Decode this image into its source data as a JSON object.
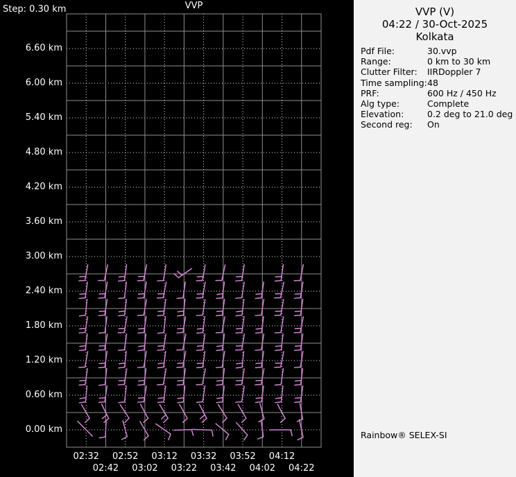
{
  "plot": {
    "title": "VVP",
    "step_label": "Step: 0.30 km",
    "y_labels": [
      "6.60 km",
      "6.00 km",
      "5.40 km",
      "4.80 km",
      "4.20 km",
      "3.60 km",
      "3.00 km",
      "2.40 km",
      "1.80 km",
      "1.20 km",
      "0.60 km",
      "0.00 km"
    ],
    "x_labels_row1": [
      "02:32",
      "02:52",
      "03:12",
      "03:32",
      "03:52",
      "04:12"
    ],
    "x_labels_row2": [
      "02:42",
      "03:02",
      "03:22",
      "03:42",
      "04:02",
      "04:22"
    ]
  },
  "chart_data": {
    "type": "wind-barb-profile",
    "title": "VVP",
    "x_times": [
      "02:32",
      "02:42",
      "02:52",
      "03:02",
      "03:12",
      "03:22",
      "03:32",
      "03:42",
      "03:52",
      "04:02",
      "04:12",
      "04:22"
    ],
    "heights_km": [
      2.7,
      2.4,
      2.1,
      1.8,
      1.5,
      1.2,
      0.9,
      0.6,
      0.3,
      0.0
    ],
    "height_axis": {
      "min": 0.0,
      "max": 7.2,
      "step_km": 0.3,
      "labeled_step_km": 0.6,
      "unit": "km"
    },
    "time_step_min": 10,
    "angles_deg": [
      [
        10,
        12,
        8,
        11,
        9,
        55,
        10,
        12,
        9,
        null,
        8,
        11
      ],
      [
        8,
        10,
        7,
        9,
        11,
        8,
        10,
        7,
        9,
        8,
        12,
        9
      ],
      [
        6,
        9,
        7,
        10,
        8,
        6,
        9,
        8,
        7,
        9,
        10,
        8
      ],
      [
        9,
        7,
        10,
        8,
        6,
        9,
        7,
        10,
        8,
        7,
        9,
        11
      ],
      [
        7,
        10,
        8,
        6,
        9,
        11,
        8,
        7,
        10,
        9,
        7,
        8
      ],
      [
        10,
        8,
        6,
        9,
        7,
        10,
        8,
        9,
        6,
        8,
        11,
        9
      ],
      [
        8,
        6,
        9,
        7,
        10,
        8,
        11,
        7,
        9,
        10,
        8,
        7
      ],
      [
        5,
        8,
        6,
        9,
        7,
        5,
        8,
        6,
        9,
        7,
        6,
        8
      ],
      [
        -30,
        -26,
        -33,
        -28,
        -31,
        -29,
        -27,
        -32,
        -30,
        -15,
        -28,
        -10
      ],
      [
        -45,
        3,
        -15,
        -30,
        -55,
        -92,
        -88,
        -50,
        -42,
        -8,
        -90,
        -12
      ]
    ],
    "feather_counts": [
      [
        2,
        1,
        2,
        2,
        1,
        2,
        2,
        1,
        2,
        0,
        2,
        1
      ],
      [
        2,
        2,
        1,
        2,
        2,
        1,
        2,
        2,
        1,
        2,
        2,
        2
      ],
      [
        1,
        2,
        2,
        1,
        2,
        2,
        1,
        2,
        2,
        1,
        2,
        2
      ],
      [
        2,
        1,
        2,
        2,
        1,
        2,
        2,
        1,
        2,
        2,
        1,
        2
      ],
      [
        2,
        2,
        1,
        2,
        2,
        1,
        2,
        2,
        2,
        1,
        2,
        2
      ],
      [
        1,
        2,
        2,
        1,
        2,
        2,
        2,
        1,
        2,
        2,
        2,
        1
      ],
      [
        2,
        1,
        2,
        2,
        1,
        2,
        1,
        2,
        2,
        2,
        1,
        2
      ],
      [
        2,
        2,
        1,
        2,
        2,
        2,
        1,
        2,
        1,
        2,
        2,
        2
      ],
      [
        1,
        2,
        1,
        1,
        2,
        1,
        2,
        1,
        1,
        1,
        1,
        1
      ],
      [
        0,
        1,
        1,
        1,
        1,
        1,
        1,
        1,
        1,
        1,
        1,
        1
      ]
    ],
    "staff_length_default": 23,
    "staff_lengths_bottom_row": [
      30,
      24,
      24,
      24,
      26,
      26,
      28,
      24,
      24,
      24,
      30,
      26
    ]
  },
  "colors": {
    "barb": "#d284d2",
    "grid_solid": "#8f8f8f",
    "grid_dotted": "#e6e6e6",
    "plot_text": "#ffffff",
    "panel_bg": "#f2f2f2",
    "panel_text": "#000000"
  },
  "panel": {
    "title": "VVP (V)",
    "datetime": "04:22 / 30-Oct-2025",
    "location": "Kolkata",
    "fields": [
      {
        "label": "Pdf File:",
        "value": "30.vvp"
      },
      {
        "label": "Range:",
        "value": "0 km to 30 km"
      },
      {
        "label": "Clutter Filter:",
        "value": "IIRDoppler 7"
      },
      {
        "label": "Time sampling:",
        "value": "48"
      },
      {
        "label": "PRF:",
        "value": "600 Hz / 450 Hz"
      },
      {
        "label": "Alg type:",
        "value": "Complete"
      },
      {
        "label": "Elevation:",
        "value": "0.2 deg to 21.0 deg"
      },
      {
        "label": "Second reg:",
        "value": "On"
      }
    ],
    "footer": "Rainbow® SELEX-SI"
  }
}
